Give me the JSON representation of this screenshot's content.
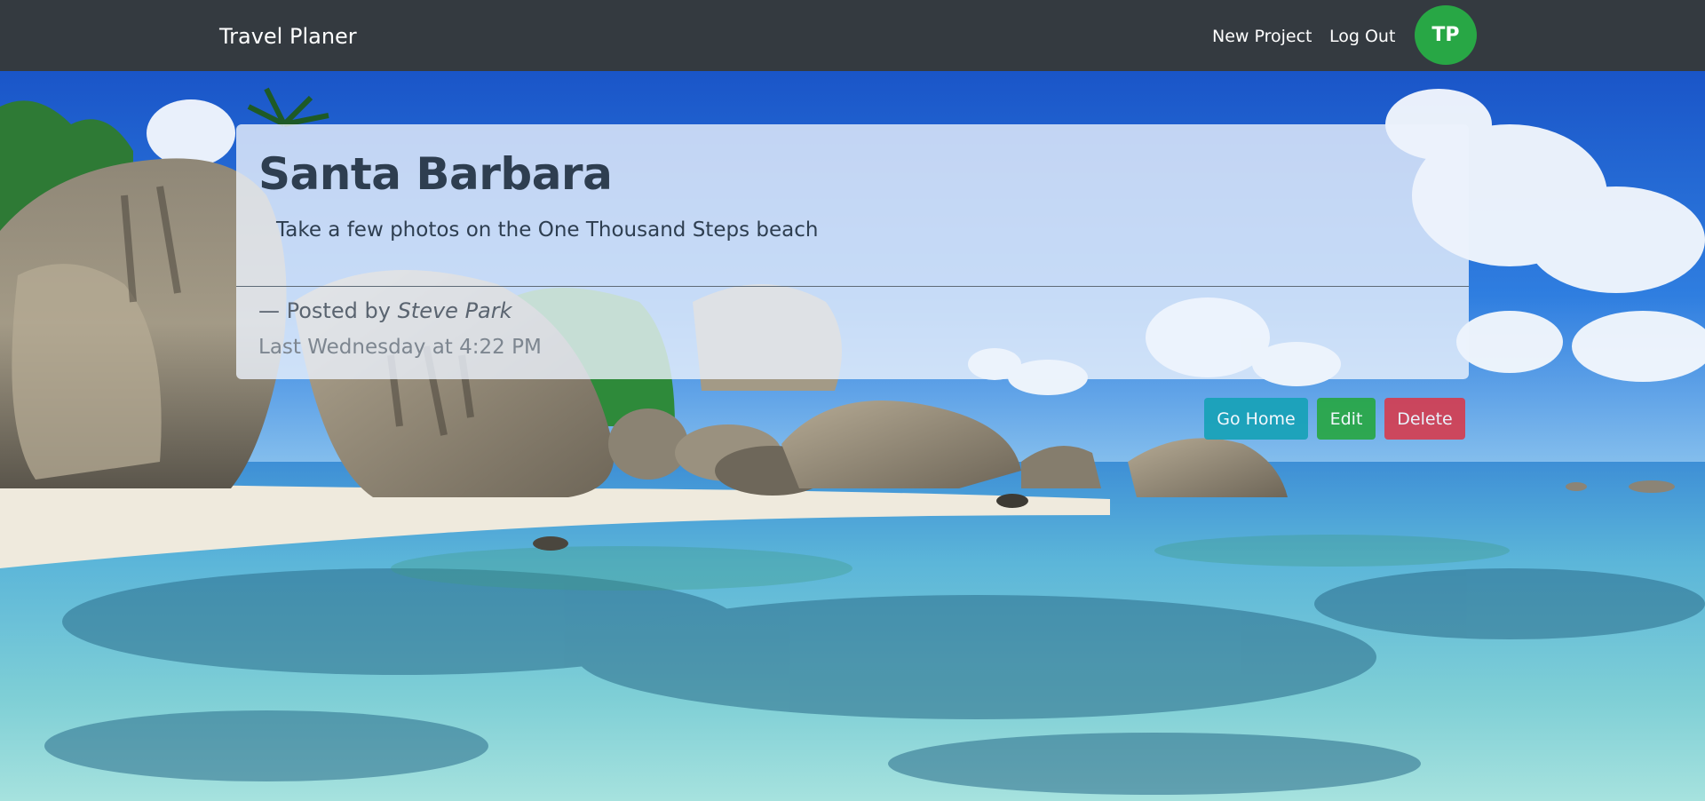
{
  "navbar": {
    "brand": "Travel Planer",
    "links": {
      "new_project": "New Project",
      "log_out": "Log Out"
    },
    "avatar_initials": "TP",
    "avatar_color": "#28a745",
    "background_color": "#343a40"
  },
  "post": {
    "title": "Santa Barbara",
    "description": "Take a few photos on the One Thousand Steps beach",
    "posted_by_prefix": "— Posted by",
    "author": "Steve Park",
    "timestamp": "Last Wednesday at 4:22 PM"
  },
  "actions": {
    "go_home": "Go Home",
    "edit": "Edit",
    "delete": "Delete"
  },
  "colors": {
    "info": "#17a2b8",
    "success": "#28a745",
    "danger": "#dc3545"
  }
}
